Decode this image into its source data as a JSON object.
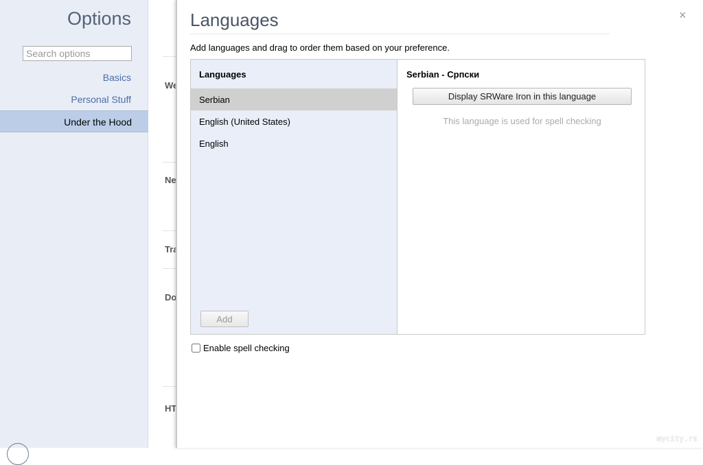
{
  "sidebar": {
    "title": "Options",
    "search_placeholder": "Search options",
    "items": [
      {
        "label": "Basics"
      },
      {
        "label": "Personal Stuff"
      },
      {
        "label": "Under the Hood"
      }
    ]
  },
  "underlying": {
    "labels": [
      "We",
      "Ne",
      "Tra",
      "Do",
      "HT"
    ]
  },
  "dialog": {
    "title": "Languages",
    "close": "×",
    "description": "Add languages and drag to order them based on your preference.",
    "list_header": "Languages",
    "languages": [
      {
        "label": "Serbian"
      },
      {
        "label": "English (United States)"
      },
      {
        "label": "English"
      }
    ],
    "add_label": "Add",
    "selected_header": "Serbian - Српски",
    "display_button": "Display SRWare Iron in this language",
    "spell_note": "This language is used for spell checking",
    "spell_checkbox": "Enable spell checking"
  },
  "watermark": "mycity.rs"
}
